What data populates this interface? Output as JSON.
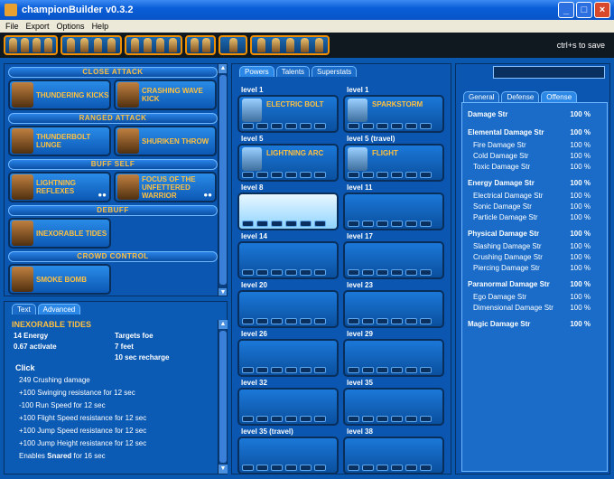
{
  "window": {
    "title": "championBuilder v0.3.2"
  },
  "menu": [
    "File",
    "Export",
    "Options",
    "Help"
  ],
  "toolbar": {
    "hint": "ctrl+s to save"
  },
  "categories": [
    {
      "name": "CLOSE ATTACK",
      "powers": [
        {
          "label": "THUNDERING KICKS",
          "badge": ""
        },
        {
          "label": "CRASHING WAVE KICK",
          "badge": ""
        }
      ]
    },
    {
      "name": "RANGED ATTACK",
      "powers": [
        {
          "label": "THUNDERBOLT LUNGE",
          "badge": ""
        },
        {
          "label": "SHURIKEN THROW",
          "badge": ""
        }
      ]
    },
    {
      "name": "BUFF SELF",
      "powers": [
        {
          "label": "LIGHTNING REFLEXES",
          "badge": "●●"
        },
        {
          "label": "FOCUS OF THE UNFETTERED WARRIOR",
          "badge": "●●"
        }
      ]
    },
    {
      "name": "DEBUFF",
      "powers": [
        {
          "label": "INEXORABLE TIDES",
          "badge": ""
        }
      ]
    },
    {
      "name": "CROWD CONTROL",
      "powers": [
        {
          "label": "SMOKE BOMB",
          "badge": ""
        }
      ]
    }
  ],
  "info": {
    "tabs": [
      "Text",
      "Advanced"
    ],
    "title": "INEXORABLE TIDES",
    "energy": "14 Energy",
    "activate": "0.67 activate",
    "targets": "Targets foe",
    "range": "7 feet",
    "recharge": "10 sec recharge",
    "click": "Click",
    "effects": [
      "249 Crushing damage",
      "+100 Swinging resistance for 12 sec",
      "-100 Run Speed for 12 sec",
      "+100 Flight Speed resistance for 12 sec",
      "+100 Jump Speed resistance for 12 sec",
      "+100 Jump Height resistance for 12 sec"
    ],
    "enables_pre": "Enables",
    "enables_bold": "Snared",
    "enables_post": "for 16 sec"
  },
  "mid_tabs": [
    "Powers",
    "Talents",
    "Superstats"
  ],
  "slots": [
    {
      "level": "level 1",
      "name": "ELECTRIC BOLT"
    },
    {
      "level": "level 1",
      "name": "SPARKSTORM"
    },
    {
      "level": "level 5",
      "name": "LIGHTNING ARC"
    },
    {
      "level": "level 5 (travel)",
      "name": "FLIGHT"
    },
    {
      "level": "level 8",
      "name": ""
    },
    {
      "level": "level 11",
      "name": ""
    },
    {
      "level": "level 14",
      "name": ""
    },
    {
      "level": "level 17",
      "name": ""
    },
    {
      "level": "level 20",
      "name": ""
    },
    {
      "level": "level 23",
      "name": ""
    },
    {
      "level": "level 26",
      "name": ""
    },
    {
      "level": "level 29",
      "name": ""
    },
    {
      "level": "level 32",
      "name": ""
    },
    {
      "level": "level 35",
      "name": ""
    },
    {
      "level": "level 35 (travel)",
      "name": ""
    },
    {
      "level": "level 38",
      "name": ""
    }
  ],
  "right_tabs": [
    "General",
    "Defense",
    "Offense"
  ],
  "stats": [
    {
      "name": "Damage Str",
      "value": "100 %",
      "kind": "h"
    },
    {
      "name": "Elemental Damage Str",
      "value": "100 %",
      "kind": "h"
    },
    {
      "name": "Fire Damage Str",
      "value": "100 %",
      "kind": "sub"
    },
    {
      "name": "Cold Damage Str",
      "value": "100 %",
      "kind": "sub"
    },
    {
      "name": "Toxic Damage Str",
      "value": "100 %",
      "kind": "sub"
    },
    {
      "name": "Energy Damage Str",
      "value": "100 %",
      "kind": "h"
    },
    {
      "name": "Electrical Damage Str",
      "value": "100 %",
      "kind": "sub"
    },
    {
      "name": "Sonic Damage Str",
      "value": "100 %",
      "kind": "sub"
    },
    {
      "name": "Particle Damage Str",
      "value": "100 %",
      "kind": "sub"
    },
    {
      "name": "Physical Damage Str",
      "value": "100 %",
      "kind": "h"
    },
    {
      "name": "Slashing Damage Str",
      "value": "100 %",
      "kind": "sub"
    },
    {
      "name": "Crushing Damage Str",
      "value": "100 %",
      "kind": "sub"
    },
    {
      "name": "Piercing Damage Str",
      "value": "100 %",
      "kind": "sub"
    },
    {
      "name": "Paranormal Damage Str",
      "value": "100 %",
      "kind": "h"
    },
    {
      "name": "Ego Damage Str",
      "value": "100 %",
      "kind": "sub"
    },
    {
      "name": "Dimensional Damage Str",
      "value": "100 %",
      "kind": "sub"
    },
    {
      "name": "Magic Damage Str",
      "value": "100 %",
      "kind": "h"
    }
  ]
}
